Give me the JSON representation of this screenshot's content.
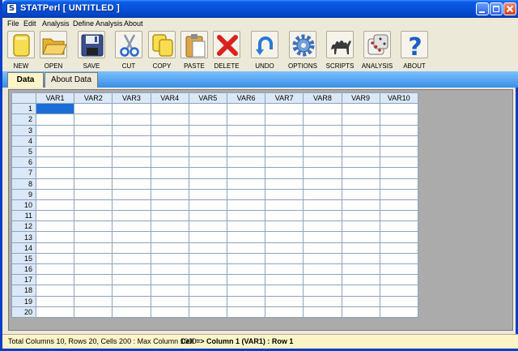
{
  "window": {
    "title": "STATPerl [ UNTITLED ]",
    "icon_glyph": "S",
    "title_color": "#0852d8"
  },
  "menu": [
    "File",
    "Edit",
    "Analysis",
    "Define Analysis",
    "About"
  ],
  "toolbar": [
    {
      "label": "NEW",
      "icon": "new-document-icon"
    },
    {
      "label": "OPEN",
      "icon": "open-folder-icon"
    },
    {
      "label": "SAVE",
      "icon": "floppy-disk-icon"
    },
    {
      "label": "CUT",
      "icon": "scissors-icon"
    },
    {
      "label": "COPY",
      "icon": "copy-icon"
    },
    {
      "label": "PASTE",
      "icon": "clipboard-icon"
    },
    {
      "label": "DELETE",
      "icon": "red-x-icon"
    },
    {
      "label": "UNDO",
      "icon": "undo-arrow-icon"
    },
    {
      "label": "OPTIONS",
      "icon": "gear-icon"
    },
    {
      "label": "SCRIPTS",
      "icon": "camel-icon"
    },
    {
      "label": "ANALYSIS",
      "icon": "dice-icon"
    },
    {
      "label": "ABOUT",
      "icon": "question-mark-icon"
    }
  ],
  "tabs": [
    {
      "label": "Data",
      "active": true
    },
    {
      "label": "About Data",
      "active": false
    }
  ],
  "grid": {
    "columns": [
      "VAR1",
      "VAR2",
      "VAR3",
      "VAR4",
      "VAR5",
      "VAR6",
      "VAR7",
      "VAR8",
      "VAR9",
      "VAR10"
    ],
    "rows": [
      "1",
      "2",
      "3",
      "4",
      "5",
      "6",
      "7",
      "8",
      "9",
      "10",
      "11",
      "12",
      "13",
      "14",
      "15",
      "16",
      "17",
      "18",
      "19",
      "20"
    ],
    "selected_row": 1,
    "selected_column": 1,
    "selected_color": "#1b6ed6"
  },
  "status": {
    "summary": "Total Columns 10, Rows 20, Cells 200 : Max Column 1000",
    "cell": "Cell => Column 1 (VAR1) : Row 1"
  }
}
